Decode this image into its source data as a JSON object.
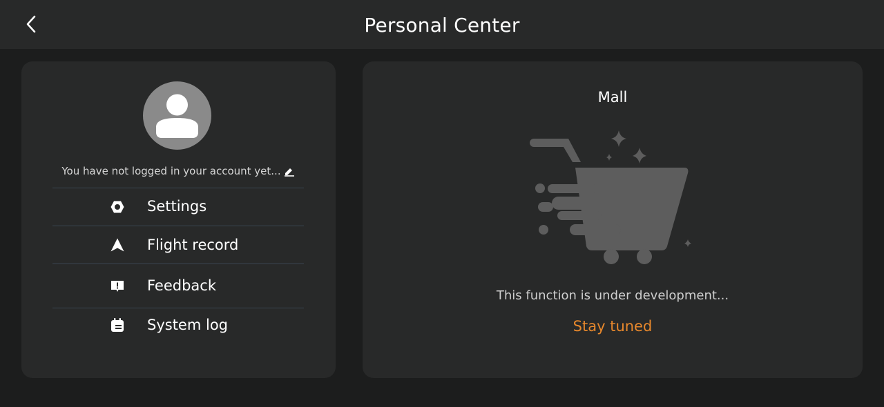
{
  "header": {
    "title": "Personal Center",
    "back_icon": "chevron-left-icon"
  },
  "profile": {
    "login_prompt": "You have not logged in your account yet...",
    "avatar_icon": "user-avatar-icon",
    "edit_icon": "pencil-icon"
  },
  "menu": {
    "items": [
      {
        "label": "Settings",
        "icon": "hexagon-icon"
      },
      {
        "label": "Flight record",
        "icon": "navigation-arrow-icon"
      },
      {
        "label": "Feedback",
        "icon": "feedback-icon"
      },
      {
        "label": "System log",
        "icon": "calendar-log-icon"
      }
    ]
  },
  "mall": {
    "title": "Mall",
    "message": "This function is under development...",
    "highlight": "Stay tuned",
    "illustration_icon": "shopping-cart-icon"
  },
  "colors": {
    "background": "#1c1d1d",
    "card": "#282929",
    "accent": "#e8882c",
    "divider": "#3a4652"
  }
}
